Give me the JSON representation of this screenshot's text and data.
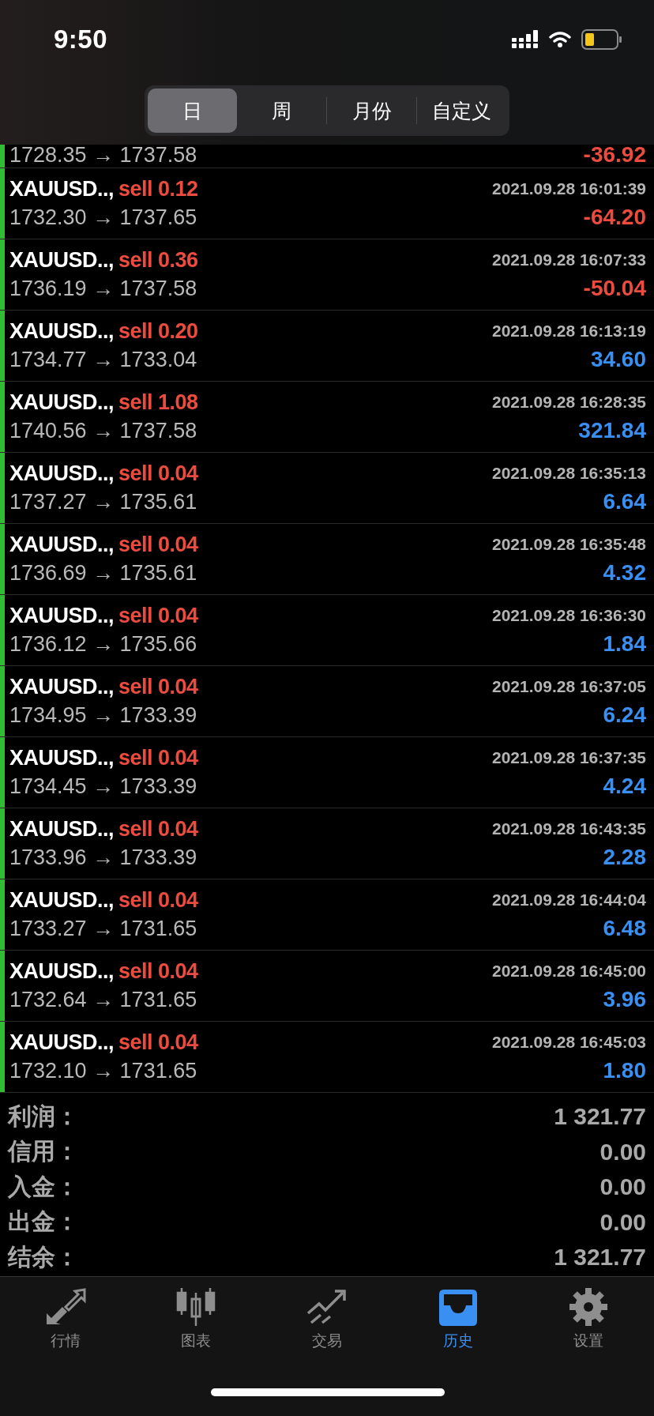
{
  "status_bar": {
    "time": "9:50"
  },
  "periods": [
    {
      "label": "日",
      "selected": true
    },
    {
      "label": "周",
      "selected": false
    },
    {
      "label": "月份",
      "selected": false
    },
    {
      "label": "自定义",
      "selected": false
    }
  ],
  "partial_row": {
    "prices": "1728.35 → 1737.58",
    "profit": "-36.92",
    "kind": "loss"
  },
  "trades": [
    {
      "symbol": "XAUUSD..,",
      "order": "sell 0.12",
      "time": "2021.09.28 16:01:39",
      "prices": "1732.30 → 1737.65",
      "profit": "-64.20",
      "kind": "loss"
    },
    {
      "symbol": "XAUUSD..,",
      "order": "sell 0.36",
      "time": "2021.09.28 16:07:33",
      "prices": "1736.19 → 1737.58",
      "profit": "-50.04",
      "kind": "loss"
    },
    {
      "symbol": "XAUUSD..,",
      "order": "sell 0.20",
      "time": "2021.09.28 16:13:19",
      "prices": "1734.77 → 1733.04",
      "profit": "34.60",
      "kind": "gain"
    },
    {
      "symbol": "XAUUSD..,",
      "order": "sell 1.08",
      "time": "2021.09.28 16:28:35",
      "prices": "1740.56 → 1737.58",
      "profit": "321.84",
      "kind": "gain"
    },
    {
      "symbol": "XAUUSD..,",
      "order": "sell 0.04",
      "time": "2021.09.28 16:35:13",
      "prices": "1737.27 → 1735.61",
      "profit": "6.64",
      "kind": "gain"
    },
    {
      "symbol": "XAUUSD..,",
      "order": "sell 0.04",
      "time": "2021.09.28 16:35:48",
      "prices": "1736.69 → 1735.61",
      "profit": "4.32",
      "kind": "gain"
    },
    {
      "symbol": "XAUUSD..,",
      "order": "sell 0.04",
      "time": "2021.09.28 16:36:30",
      "prices": "1736.12 → 1735.66",
      "profit": "1.84",
      "kind": "gain"
    },
    {
      "symbol": "XAUUSD..,",
      "order": "sell 0.04",
      "time": "2021.09.28 16:37:05",
      "prices": "1734.95 → 1733.39",
      "profit": "6.24",
      "kind": "gain"
    },
    {
      "symbol": "XAUUSD..,",
      "order": "sell 0.04",
      "time": "2021.09.28 16:37:35",
      "prices": "1734.45 → 1733.39",
      "profit": "4.24",
      "kind": "gain"
    },
    {
      "symbol": "XAUUSD..,",
      "order": "sell 0.04",
      "time": "2021.09.28 16:43:35",
      "prices": "1733.96 → 1733.39",
      "profit": "2.28",
      "kind": "gain"
    },
    {
      "symbol": "XAUUSD..,",
      "order": "sell 0.04",
      "time": "2021.09.28 16:44:04",
      "prices": "1733.27 → 1731.65",
      "profit": "6.48",
      "kind": "gain"
    },
    {
      "symbol": "XAUUSD..,",
      "order": "sell 0.04",
      "time": "2021.09.28 16:45:00",
      "prices": "1732.64 → 1731.65",
      "profit": "3.96",
      "kind": "gain"
    },
    {
      "symbol": "XAUUSD..,",
      "order": "sell 0.04",
      "time": "2021.09.28 16:45:03",
      "prices": "1732.10 → 1731.65",
      "profit": "1.80",
      "kind": "gain"
    }
  ],
  "summary": [
    {
      "label": "利润：",
      "value": "1 321.77"
    },
    {
      "label": "信用：",
      "value": "0.00"
    },
    {
      "label": "入金：",
      "value": "0.00"
    },
    {
      "label": "出金：",
      "value": "0.00"
    },
    {
      "label": "结余：",
      "value": "1 321.77"
    }
  ],
  "tab_bar": [
    {
      "kind": "quotes",
      "label": "行情",
      "selected": false
    },
    {
      "kind": "chart",
      "label": "图表",
      "selected": false
    },
    {
      "kind": "trade",
      "label": "交易",
      "selected": false
    },
    {
      "kind": "history",
      "label": "历史",
      "selected": true
    },
    {
      "kind": "settings",
      "label": "设置",
      "selected": false
    }
  ]
}
